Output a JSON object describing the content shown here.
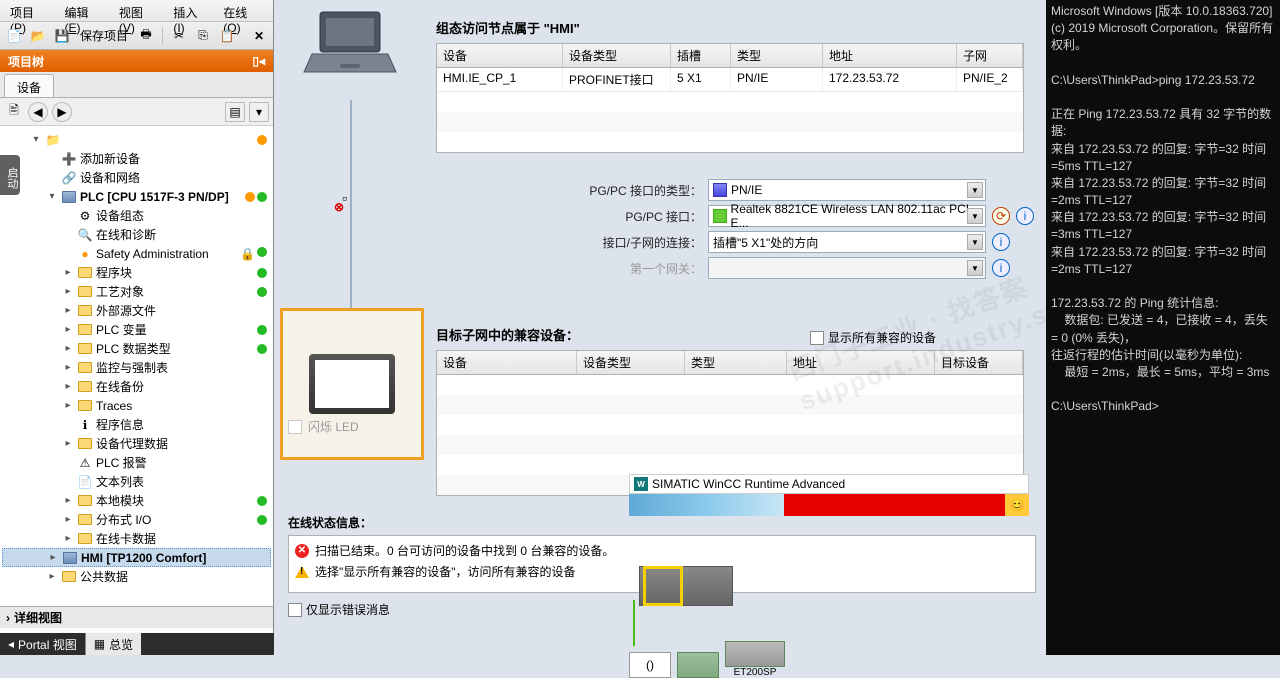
{
  "menu": {
    "items": [
      {
        "label": "项目",
        "hk": "P"
      },
      {
        "label": "编辑",
        "hk": "E"
      },
      {
        "label": "视图",
        "hk": "V"
      },
      {
        "label": "插入",
        "hk": "I"
      },
      {
        "label": "在线",
        "hk": "O"
      }
    ]
  },
  "toolbar": {
    "save_label": "保存项目"
  },
  "project_tree": {
    "title": "项目树",
    "tab": "设备",
    "side_tab": "启动",
    "detail": "详细视图",
    "bottom_portal": "Portal 视图",
    "bottom_overview": "总览",
    "items": [
      {
        "ind": "i2",
        "exp": "▾",
        "icon": "proj",
        "label": "",
        "status": [
          "o"
        ]
      },
      {
        "ind": "i3",
        "exp": "",
        "icon": "add",
        "label": "添加新设备",
        "status": []
      },
      {
        "ind": "i3",
        "exp": "",
        "icon": "net",
        "label": "设备和网络",
        "status": []
      },
      {
        "ind": "i3",
        "exp": "▾",
        "icon": "plc",
        "label": "PLC [CPU 1517F-3 PN/DP]",
        "bold": true,
        "status": [
          "o",
          "g"
        ]
      },
      {
        "ind": "i4",
        "exp": "",
        "icon": "dev",
        "label": "设备组态",
        "status": []
      },
      {
        "ind": "i4",
        "exp": "",
        "icon": "diag",
        "label": "在线和诊断",
        "status": []
      },
      {
        "ind": "i4",
        "exp": "",
        "icon": "safe",
        "label": "Safety Administration",
        "status": [
          "lock",
          "g"
        ]
      },
      {
        "ind": "i4",
        "exp": "▸",
        "icon": "folder",
        "label": "程序块",
        "status": [
          "g"
        ]
      },
      {
        "ind": "i4",
        "exp": "▸",
        "icon": "folder",
        "label": "工艺对象",
        "status": [
          "g"
        ]
      },
      {
        "ind": "i4",
        "exp": "▸",
        "icon": "folder",
        "label": "外部源文件",
        "status": []
      },
      {
        "ind": "i4",
        "exp": "▸",
        "icon": "folder",
        "label": "PLC 变量",
        "status": [
          "g"
        ]
      },
      {
        "ind": "i4",
        "exp": "▸",
        "icon": "folder",
        "label": "PLC 数据类型",
        "status": [
          "g"
        ]
      },
      {
        "ind": "i4",
        "exp": "▸",
        "icon": "folder",
        "label": "监控与强制表",
        "status": []
      },
      {
        "ind": "i4",
        "exp": "▸",
        "icon": "folder",
        "label": "在线备份",
        "status": []
      },
      {
        "ind": "i4",
        "exp": "▸",
        "icon": "folder",
        "label": "Traces",
        "status": []
      },
      {
        "ind": "i4",
        "exp": "",
        "icon": "info",
        "label": "程序信息",
        "status": []
      },
      {
        "ind": "i4",
        "exp": "▸",
        "icon": "folder",
        "label": "设备代理数据",
        "status": []
      },
      {
        "ind": "i4",
        "exp": "",
        "icon": "alarm",
        "label": "PLC 报警",
        "status": []
      },
      {
        "ind": "i4",
        "exp": "",
        "icon": "txt",
        "label": "文本列表",
        "status": []
      },
      {
        "ind": "i4",
        "exp": "▸",
        "icon": "folder",
        "label": "本地模块",
        "status": [
          "g"
        ]
      },
      {
        "ind": "i4",
        "exp": "▸",
        "icon": "folder",
        "label": "分布式 I/O",
        "status": [
          "g"
        ]
      },
      {
        "ind": "i4",
        "exp": "▸",
        "icon": "folder",
        "label": "在线卡数据",
        "status": []
      },
      {
        "ind": "i3",
        "exp": "▸",
        "icon": "hmi",
        "label": "HMI [TP1200 Comfort]",
        "sel": true,
        "bold": true,
        "status": []
      },
      {
        "ind": "i3",
        "exp": "▸",
        "icon": "folder",
        "label": "公共数据",
        "status": []
      }
    ]
  },
  "main": {
    "section1": "组态访问节点属于 \"HMI\"",
    "table1": {
      "cols": [
        "设备",
        "设备类型",
        "插槽",
        "类型",
        "地址",
        "子网"
      ],
      "row": [
        "HMI.IE_CP_1",
        "PROFINET接口",
        "5 X1",
        "PN/IE",
        "172.23.53.72",
        "PN/IE_2"
      ]
    },
    "form": {
      "pgpc_type_label": "PG/PC 接口的类型：",
      "pgpc_type_value": "PN/IE",
      "pgpc_if_label": "PG/PC 接口：",
      "pgpc_if_value": "Realtek 8821CE Wireless LAN 802.11ac PCI-E...",
      "conn_label": "接口/子网的连接：",
      "conn_value": "插槽\"5 X1\"处的方向",
      "gateway_label": "第一个网关：",
      "gateway_value": ""
    },
    "section2": "目标子网中的兼容设备：",
    "show_all": "显示所有兼容的设备",
    "table2": {
      "cols": [
        "设备",
        "设备类型",
        "类型",
        "地址",
        "目标设备"
      ]
    },
    "flash_led": "闪烁 LED",
    "status_title": "在线状态信息：",
    "status_lines": [
      {
        "type": "err",
        "text": "扫描已结束。0 台可访问的设备中找到 0 台兼容的设备。"
      },
      {
        "type": "warn",
        "text": "选择\"显示所有兼容的设备\"，访问所有兼容的设备"
      }
    ],
    "only_errors": "仅显示错误消息"
  },
  "wincc": {
    "title": "SIMATIC WinCC Runtime Advanced",
    "face": "😊",
    "hw_slot": "()",
    "hw_label": "ET200SP"
  },
  "terminal": {
    "text": "Microsoft Windows [版本 10.0.18363.720]\n(c) 2019 Microsoft Corporation。保留所有权利。\n\nC:\\Users\\ThinkPad>ping 172.23.53.72\n\n正在 Ping 172.23.53.72 具有 32 字节的数据:\n来自 172.23.53.72 的回复: 字节=32 时间=5ms TTL=127\n来自 172.23.53.72 的回复: 字节=32 时间=2ms TTL=127\n来自 172.23.53.72 的回复: 字节=32 时间=3ms TTL=127\n来自 172.23.53.72 的回复: 字节=32 时间=2ms TTL=127\n\n172.23.53.72 的 Ping 统计信息:\n    数据包: 已发送 = 4，已接收 = 4，丢失 = 0 (0% 丢失)，\n往返行程的估计时间(以毫秒为单位):\n    最短 = 2ms，最长 = 5ms，平均 = 3ms\n\nC:\\Users\\ThinkPad>"
  },
  "watermark": "西门子工业 · 找答案 support.industry.siemens.com/cs"
}
